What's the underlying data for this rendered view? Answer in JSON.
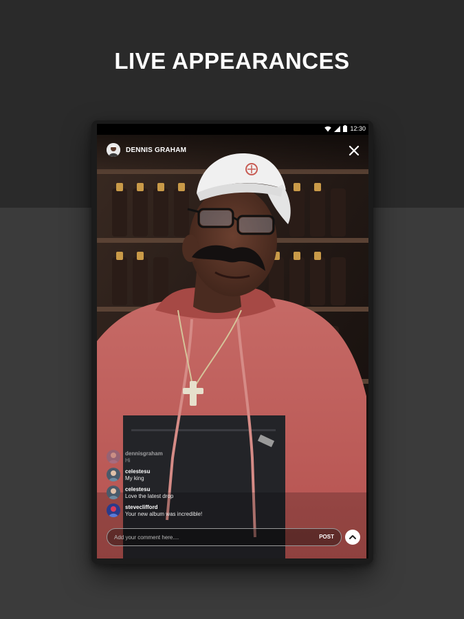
{
  "headline": "LIVE APPEARANCES",
  "status_bar": {
    "time": "12:30",
    "icons": [
      "wifi-icon",
      "signal-icon",
      "battery-icon"
    ]
  },
  "live": {
    "host_name": "DENNIS GRAHAM",
    "close_icon": "close-icon"
  },
  "chat": [
    {
      "user": "dennisgraham",
      "text": "Hi"
    },
    {
      "user": "celestesu",
      "text": "My king"
    },
    {
      "user": "celestesu",
      "text": "Love the latest drop"
    },
    {
      "user": "steveclifford",
      "text": "Your new album was incredible!"
    }
  ],
  "comment": {
    "placeholder": "Add your comment here....",
    "post_label": "POST",
    "send_icon": "chevron-up-icon"
  },
  "colors": {
    "page_top": "#2a2a2a",
    "page_bottom": "#3b3b3b",
    "hoodie": "#c0605e",
    "cap": "#f2f2f2"
  }
}
